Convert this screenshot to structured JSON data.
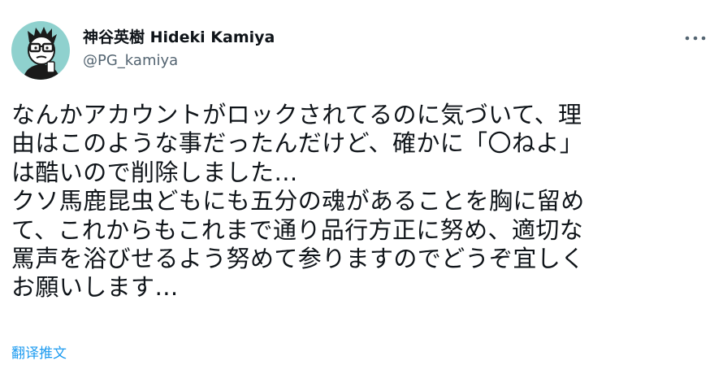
{
  "author": {
    "display_name": "神谷英樹 Hideki Kamiya",
    "handle": "@PG_kamiya",
    "avatar_icon": "cartoon-avatar-icon",
    "avatar_bg": "#8fd1ce"
  },
  "more_icon": "more-horizontal-icon",
  "tweet": {
    "lines": [
      "なんかアカウントがロックされてるのに気づいて、理",
      "由はこのような事だったんだけど、確かに「〇ねよ」",
      "は酷いので削除しました…",
      "クソ馬鹿昆虫どもにも五分の魂があることを胸に留め",
      "て、これからもこれまで通り品行方正に努め、適切な",
      "罵声を浴びせるよう努めて参りますのでどうぞ宜しく",
      "お願いします…"
    ]
  },
  "translate_label": "翻译推文",
  "colors": {
    "text": "#0f1419",
    "secondary": "#536471",
    "link": "#1d9bf0"
  }
}
